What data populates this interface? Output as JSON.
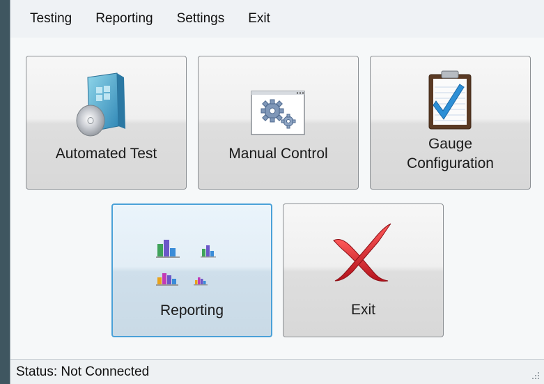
{
  "menu": {
    "items": [
      {
        "label": "Testing"
      },
      {
        "label": "Reporting"
      },
      {
        "label": "Settings"
      },
      {
        "label": "Exit"
      }
    ]
  },
  "tiles": {
    "automated_test": {
      "label": "Automated Test",
      "icon": "windows-install-disc-icon"
    },
    "manual_control": {
      "label": "Manual Control",
      "icon": "gears-window-icon"
    },
    "gauge_configuration": {
      "label_line1": "Gauge",
      "label_line2": "Configuration",
      "icon": "clipboard-check-icon"
    },
    "reporting": {
      "label": "Reporting",
      "icon": "bar-charts-icon"
    },
    "exit": {
      "label": "Exit",
      "icon": "red-x-icon"
    }
  },
  "status": {
    "text": "Status: Not Connected"
  },
  "colors": {
    "focus_border": "#4aa1d8",
    "exit_red": "#d0222c",
    "checkmark_blue": "#2d8fd6"
  }
}
